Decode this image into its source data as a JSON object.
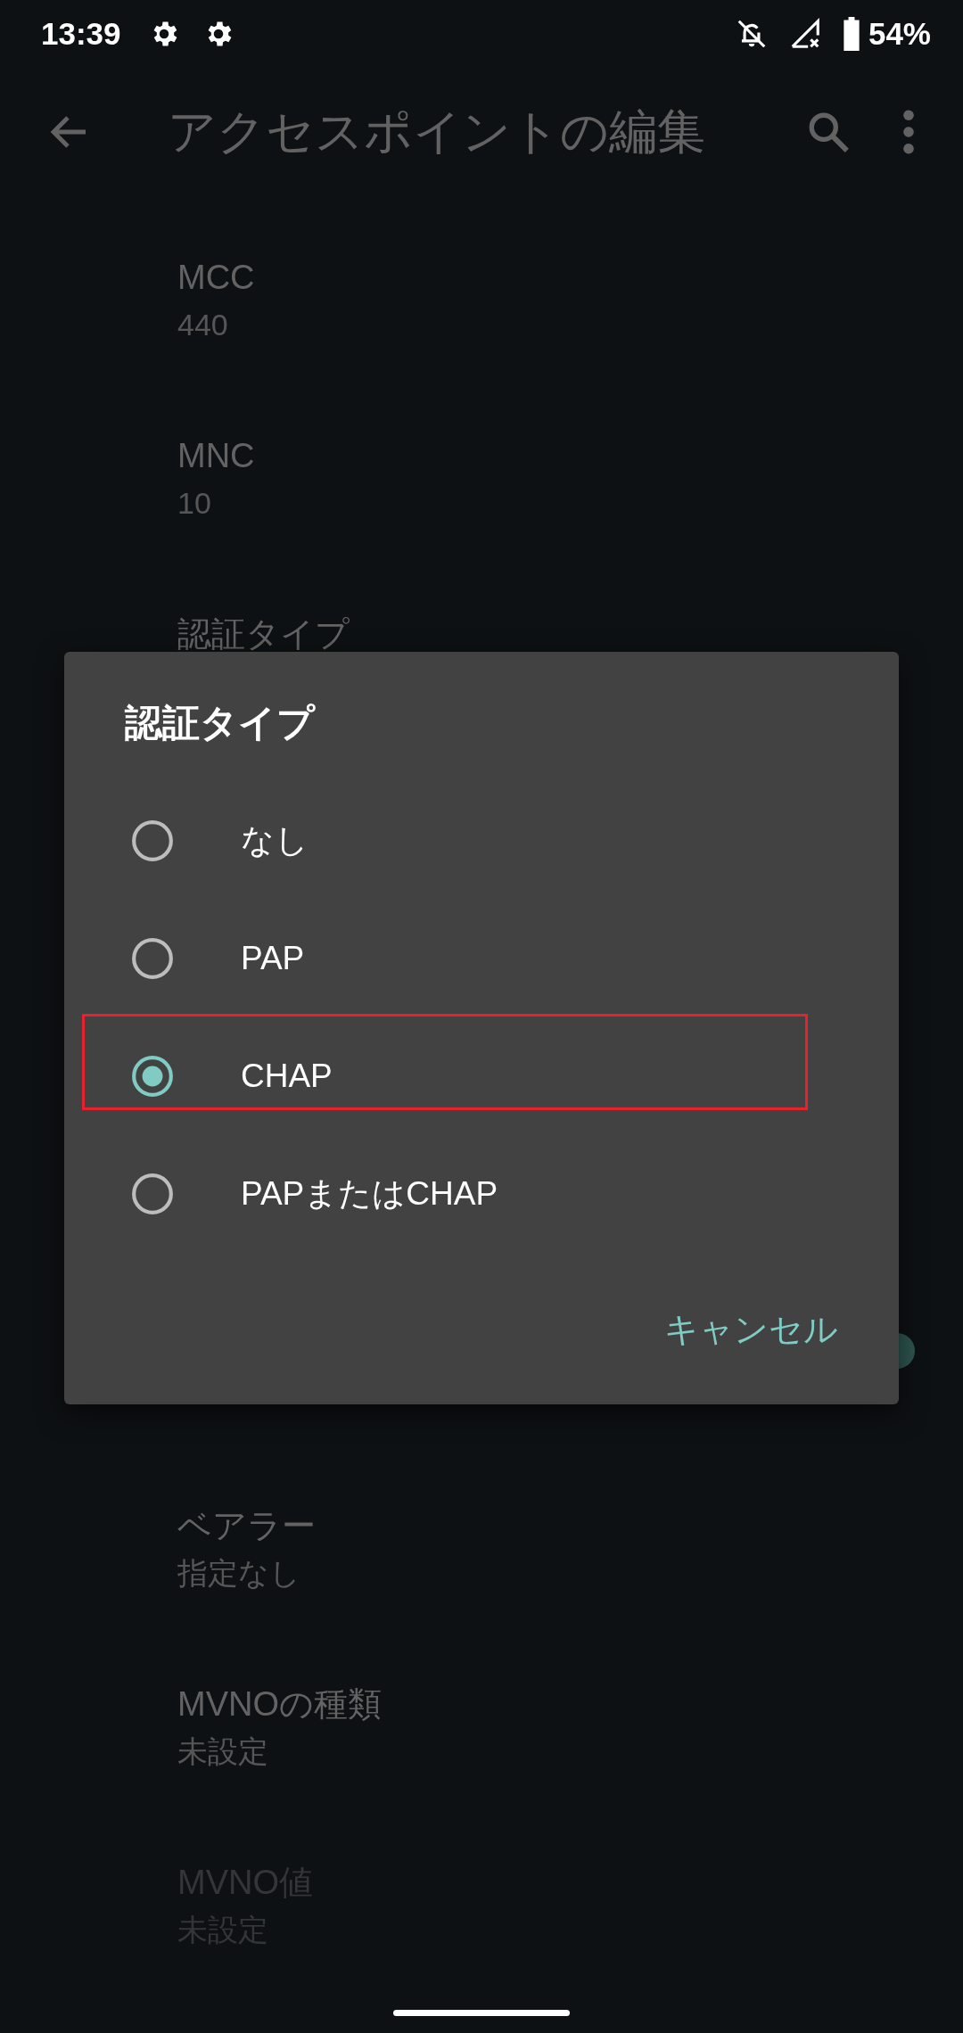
{
  "status_bar": {
    "time": "13:39",
    "battery": "54%"
  },
  "app_bar": {
    "title": "アクセスポイントの編集"
  },
  "settings": [
    {
      "title": "MCC",
      "value": "440",
      "disabled": false
    },
    {
      "title": "MNC",
      "value": "10",
      "disabled": false
    },
    {
      "title": "認証タイプ",
      "disabled": false
    }
  ],
  "settings_lower": [
    {
      "kind": "switch",
      "on": true,
      "disabled": false
    },
    {
      "kind": "text",
      "title": "ベアラー",
      "value": "指定なし",
      "disabled": false
    },
    {
      "kind": "text",
      "title": "MVNOの種類",
      "value": "未設定",
      "disabled": false
    },
    {
      "kind": "text",
      "title": "MVNO値",
      "value": "未設定",
      "disabled": true
    }
  ],
  "dialog": {
    "title": "認証タイプ",
    "options": [
      {
        "label": "なし",
        "selected": false,
        "highlighted": false
      },
      {
        "label": "PAP",
        "selected": false,
        "highlighted": false
      },
      {
        "label": "CHAP",
        "selected": true,
        "highlighted": true
      },
      {
        "label": "PAPまたはCHAP",
        "selected": false,
        "highlighted": false
      }
    ],
    "cancel": "キャンセル"
  }
}
